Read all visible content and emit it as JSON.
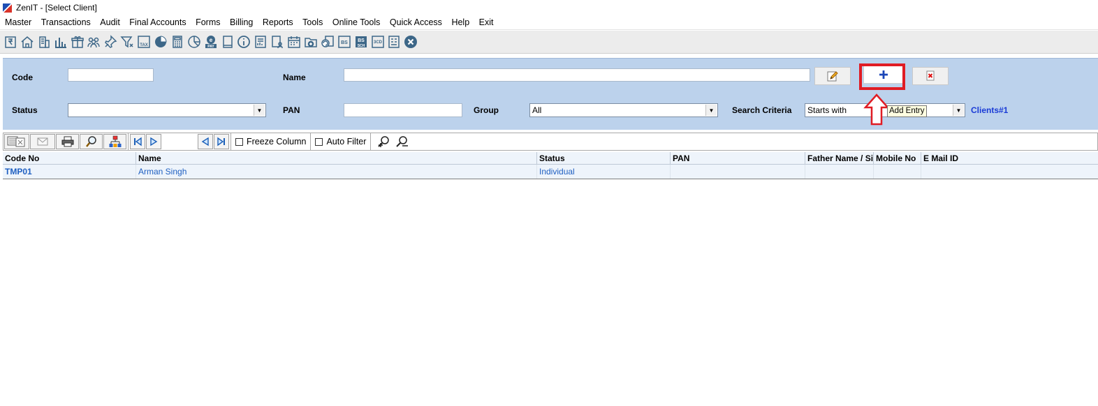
{
  "window": {
    "title": "ZenIT - [Select Client]"
  },
  "menu": [
    "Master",
    "Transactions",
    "Audit",
    "Final Accounts",
    "Forms",
    "Billing",
    "Reports",
    "Tools",
    "Online Tools",
    "Quick Access",
    "Help",
    "Exit"
  ],
  "toolbar_icons": [
    "rupee-book-icon",
    "home-icon",
    "building-icon",
    "bar-chart-icon",
    "gift-icon",
    "users-icon",
    "pin-icon",
    "filter-icon",
    "tax-icon",
    "pie-icon",
    "calculator-icon",
    "clock-chart-icon",
    "epay-icon",
    "book-icon",
    "info-icon",
    "report-icon",
    "user-doc-icon",
    "calendar-icon",
    "folder-add-icon",
    "refresh-doc-icon",
    "bs-icon",
    "bs-sch-icon",
    "3cd-icon",
    "form-icon",
    "close-circle-icon"
  ],
  "toolbar_text": {
    "tax": "TAX",
    "pay": "PAY",
    "bs": "BS",
    "bs_sch": "BS",
    "sch": "SCH",
    "three_cd": "3CD",
    "e": "e"
  },
  "filters": {
    "code_label": "Code",
    "code_value": "",
    "name_label": "Name",
    "name_value": "",
    "status_label": "Status",
    "status_value": "",
    "pan_label": "PAN",
    "pan_value": "",
    "group_label": "Group",
    "group_value": "All",
    "search_criteria_label": "Search Criteria",
    "search_criteria_value": "Starts with",
    "clients_count": "Clients#1"
  },
  "tooltip": "Add Entry",
  "grid_toolbar": {
    "freeze_column": "Freeze Column",
    "auto_filter": "Auto Filter"
  },
  "grid": {
    "columns": [
      "Code No",
      "Name",
      "Status",
      "PAN",
      "Father Name / Sig",
      "Mobile No",
      "E Mail ID"
    ],
    "rows": [
      {
        "code": "TMP01",
        "name": "Arman Singh",
        "status": "Individual",
        "pan": "",
        "father": "",
        "mobile": "",
        "email": ""
      }
    ]
  },
  "colors": {
    "panel_bg": "#bcd2ec",
    "highlight": "#e01c24",
    "link": "#1a3bd6",
    "row_text": "#1e5fc1"
  }
}
